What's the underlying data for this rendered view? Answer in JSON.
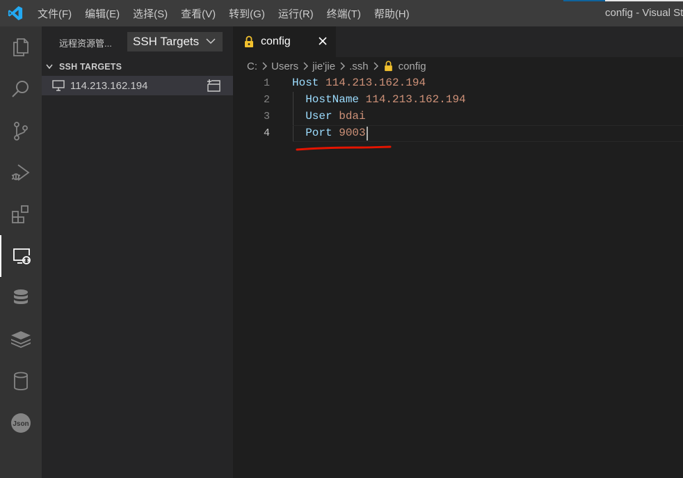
{
  "titlebar": {
    "menu": [
      "文件(F)",
      "编辑(E)",
      "选择(S)",
      "查看(V)",
      "转到(G)",
      "运行(R)",
      "终端(T)",
      "帮助(H)"
    ],
    "window_title": "config - Visual Stu"
  },
  "activitybar": {
    "icons": [
      "explorer-icon",
      "search-icon",
      "source-control-icon",
      "run-debug-icon",
      "extensions-icon",
      "remote-explorer-icon",
      "database-icon",
      "redis-icon",
      "sql-icon",
      "json-icon"
    ],
    "active": "remote-explorer-icon"
  },
  "sidebar": {
    "title": "远程资源管...",
    "select_value": "SSH Targets",
    "section_label": "SSH TARGETS",
    "targets": [
      {
        "label": "114.213.162.194"
      }
    ]
  },
  "editor": {
    "tab_label": "config",
    "breadcrumb": [
      "C:",
      "Users",
      "jie'jie",
      ".ssh",
      "config"
    ],
    "lines": [
      {
        "number": "1",
        "key": "Host",
        "value": "114.213.162.194",
        "indent": ""
      },
      {
        "number": "2",
        "key": "HostName",
        "value": "114.213.162.194",
        "indent": "  "
      },
      {
        "number": "3",
        "key": "User",
        "value": "bdai",
        "indent": "  "
      },
      {
        "number": "4",
        "key": "Port",
        "value": "9003",
        "indent": "  "
      }
    ],
    "current_line": 4
  },
  "colors": {
    "keyword": "#9cdcfe",
    "value": "#ce9178",
    "annotation": "#e51400",
    "lock": "#f2c12e"
  }
}
